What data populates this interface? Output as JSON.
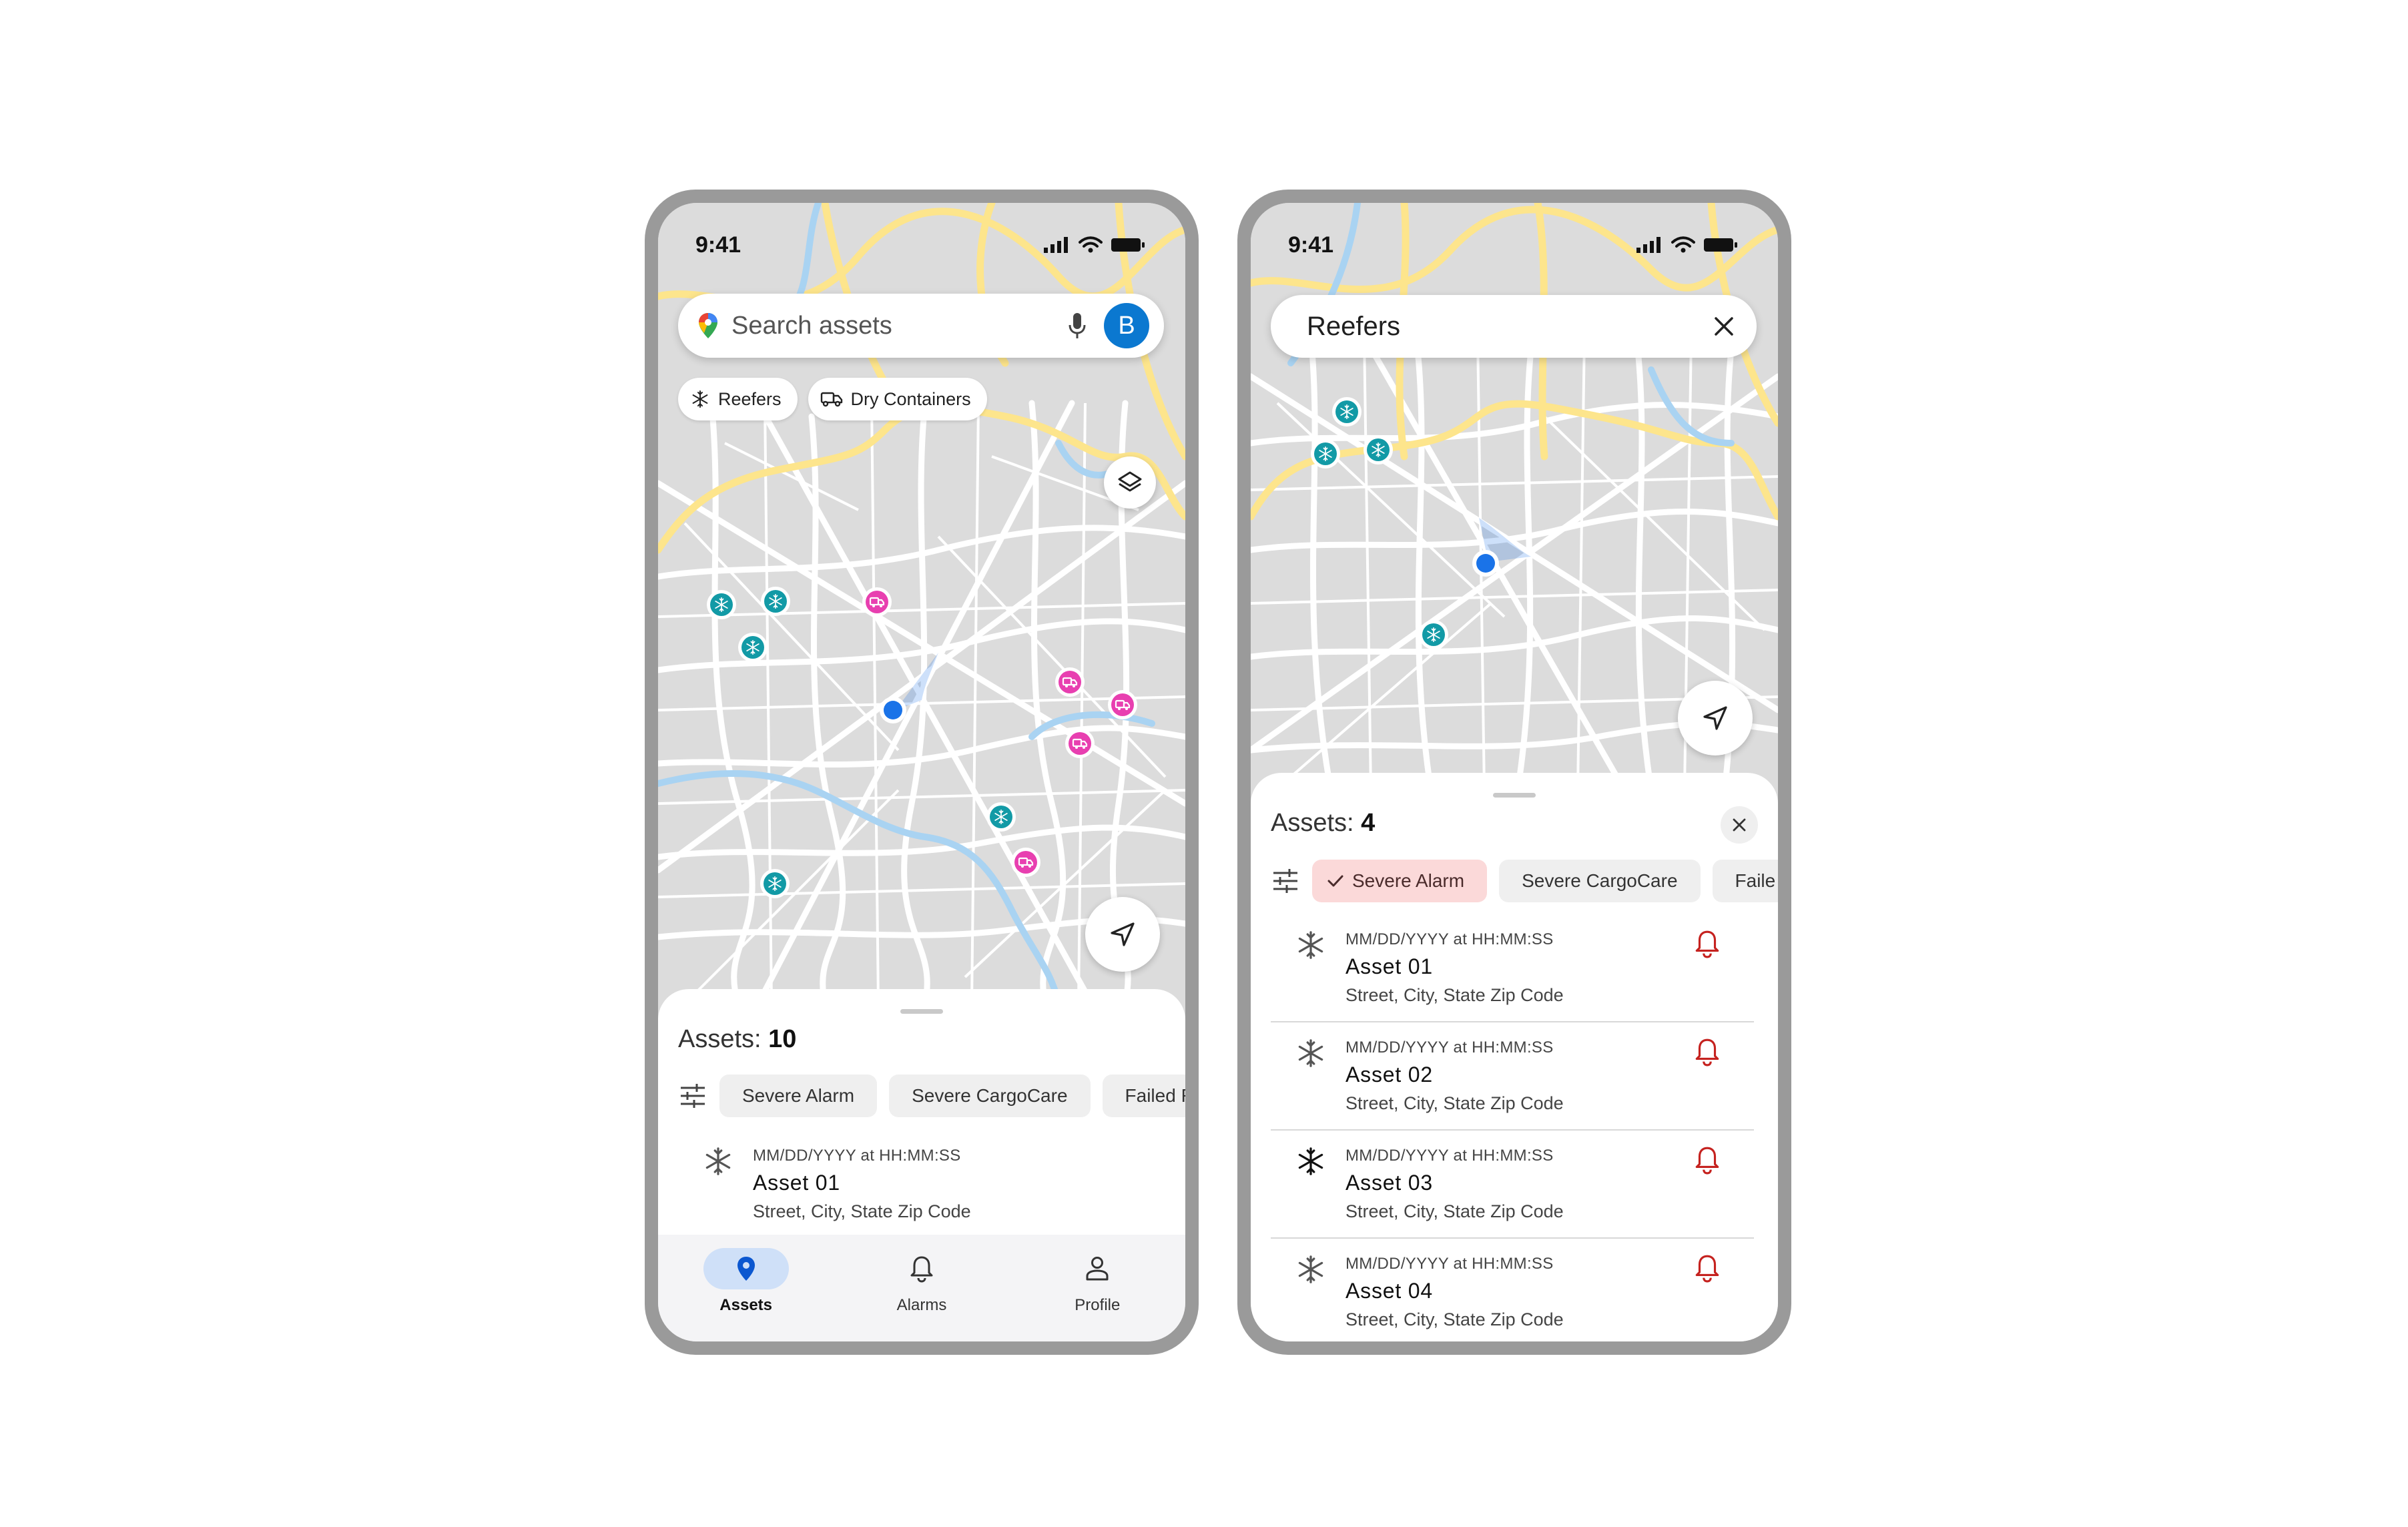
{
  "screen1": {
    "status": {
      "time": "9:41"
    },
    "search": {
      "placeholder": "Search assets",
      "avatar_initial": "B"
    },
    "category_chips": [
      "Reefers",
      "Dry Containers"
    ],
    "sheet": {
      "title_prefix": "Assets:",
      "count": "10",
      "filters": [
        "Severe Alarm",
        "Severe CargoCare",
        "Failed R"
      ],
      "assets": [
        {
          "timestamp": "MM/DD/YYYY at HH:MM:SS",
          "name": "Asset 01",
          "address": "Street, City, State Zip Code"
        }
      ]
    },
    "nav": {
      "items": [
        "Assets",
        "Alarms",
        "Profile"
      ],
      "active": "Assets"
    }
  },
  "screen2": {
    "status": {
      "time": "9:41"
    },
    "search": {
      "query": "Reefers"
    },
    "sheet": {
      "title_prefix": "Assets:",
      "count": "4",
      "filters": [
        "Severe Alarm",
        "Severe CargoCare",
        "Faile"
      ],
      "selected_filter": "Severe Alarm",
      "assets": [
        {
          "timestamp": "MM/DD/YYYY at HH:MM:SS",
          "name": "Asset 01",
          "address": "Street, City, State Zip Code"
        },
        {
          "timestamp": "MM/DD/YYYY at HH:MM:SS",
          "name": "Asset 02",
          "address": "Street, City, State Zip Code"
        },
        {
          "timestamp": "MM/DD/YYYY at HH:MM:SS",
          "name": "Asset 03",
          "address": "Street, City, State Zip Code"
        },
        {
          "timestamp": "MM/DD/YYYY at HH:MM:SS",
          "name": "Asset 04",
          "address": "Street, City, State Zip Code"
        }
      ]
    }
  },
  "colors": {
    "reefer_marker": "#129aa6",
    "dry_marker": "#e83fb0",
    "location_dot": "#1a73e8",
    "alarm_bell": "#c5221f",
    "selected_chip": "#fbd9d9",
    "avatar": "#0b78d0"
  }
}
